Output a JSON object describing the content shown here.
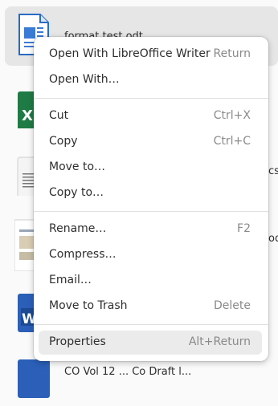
{
  "files": [
    {
      "name": "format test.odt",
      "icon": "writer-document-icon",
      "selected": true
    },
    {
      "name": "",
      "icon": "spreadsheet-icon",
      "selected": false
    },
    {
      "name": "csv",
      "icon": "text-file-icon",
      "selected": false
    },
    {
      "name": "od",
      "icon": "presentation-thumbnail-icon",
      "selected": false
    },
    {
      "name": "",
      "icon": "word-document-icon",
      "selected": false
    },
    {
      "name": "CO Vol 12 ... Co Draft l...",
      "icon": "word-document-icon",
      "selected": false
    }
  ],
  "context_menu": {
    "items": [
      {
        "label": "Open With LibreOffice Writer",
        "accel": "Return"
      },
      {
        "label": "Open With…",
        "accel": ""
      },
      {
        "label": "Cut",
        "accel": "Ctrl+X"
      },
      {
        "label": "Copy",
        "accel": "Ctrl+C"
      },
      {
        "label": "Move to…",
        "accel": ""
      },
      {
        "label": "Copy to…",
        "accel": ""
      },
      {
        "label": "Rename…",
        "accel": "F2"
      },
      {
        "label": "Compress…",
        "accel": ""
      },
      {
        "label": "Email…",
        "accel": ""
      },
      {
        "label": "Move to Trash",
        "accel": "Delete"
      },
      {
        "label": "Properties",
        "accel": "Alt+Return"
      }
    ],
    "hovered_item": "Properties"
  },
  "colors": {
    "writer_blue": "#3a7bd5",
    "excel_green": "#1e7b45",
    "word_blue": "#2b5fb8",
    "menu_hover": "#ebebeb"
  }
}
